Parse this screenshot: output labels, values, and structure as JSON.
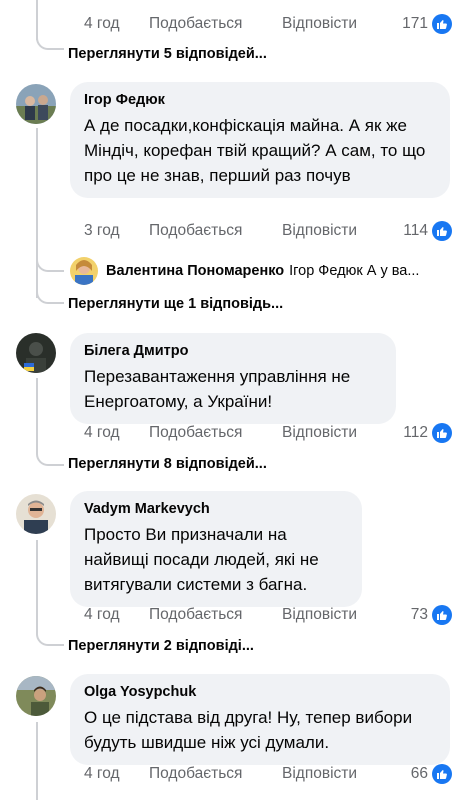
{
  "comments": [
    {
      "time": "4 год",
      "like_label": "Подобається",
      "reply_label": "Відповісти",
      "reactions": "171",
      "view_replies": "Переглянути 5 відповідей..."
    },
    {
      "author": "Ігор Федюк",
      "text": "А де посадки,конфіскація майна. А як же Міндіч, корефан твій кращий? А сам, то що про це не знав, перший раз почув",
      "time": "3 год",
      "like_label": "Подобається",
      "reply_label": "Відповісти",
      "reactions": "114",
      "reply_preview": {
        "author": "Валентина Пономаренко",
        "text": "Ігор Федюк А у ва..."
      },
      "view_replies": "Переглянути ще 1 відповідь..."
    },
    {
      "author": "Білега Дмитро",
      "text": "Перезавантаження управління не Енергоатому, а України!",
      "time": "4 год",
      "like_label": "Подобається",
      "reply_label": "Відповісти",
      "reactions": "112",
      "view_replies": "Переглянути 8 відповідей..."
    },
    {
      "author": "Vadym Markevych",
      "text": "Просто Ви призначали на найвищі посади людей, які не витягували системи з багна.",
      "time": "4 год",
      "like_label": "Подобається",
      "reply_label": "Відповісти",
      "reactions": "73",
      "view_replies": "Переглянути 2 відповіді..."
    },
    {
      "author": "Olga Yosypchuk",
      "text": "О це підстава від друга! Ну, тепер вибори будуть швидше ніж усі думали.",
      "time": "4 год",
      "like_label": "Подобається",
      "reply_label": "Відповісти",
      "reactions": "66"
    }
  ],
  "colors": {
    "bubble": "#f0f2f5",
    "meta_text": "#65676b",
    "like_blue": "#1877f2",
    "thread_line": "#ced0d4"
  },
  "icons": [
    "like-icon",
    "avatar"
  ]
}
